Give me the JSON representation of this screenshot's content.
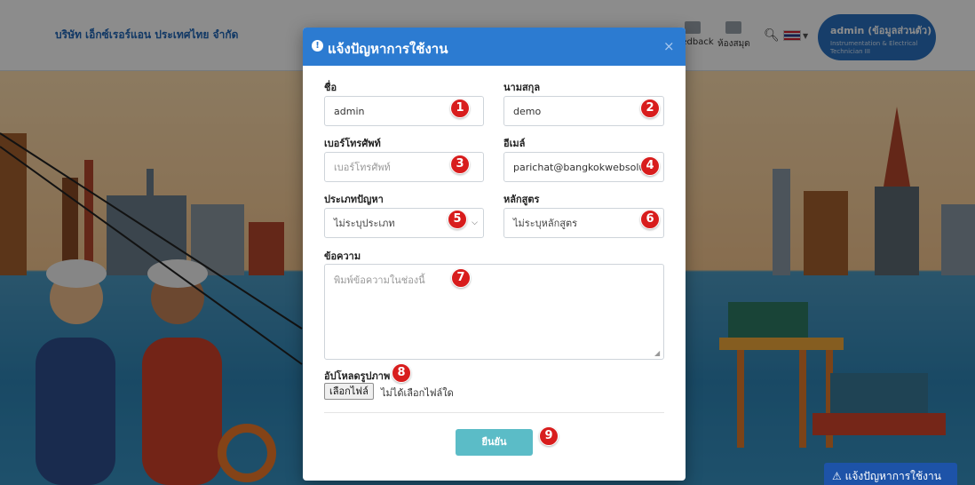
{
  "navbar": {
    "brand": "บริษัท เอ็กซ์เรอร์แอน ประเทศไทย จำกัด",
    "items": [
      {
        "label": "Feedback"
      },
      {
        "label": "ห้องสมุด"
      }
    ],
    "search_icon": "search-icon",
    "language_flag": "thailand-flag-icon",
    "user_name": "admin (ข้อมูลส่วนตัว)",
    "user_role": "Instrumentation & Electrical Technician III"
  },
  "modal": {
    "title": "แจ้งปัญหาการใช้งาน",
    "title_icon": "exclamation-circle-icon",
    "close_icon": "×",
    "header_color": "#2c7bd1",
    "fields": {
      "first_name": {
        "label": "ชื่อ",
        "value": "admin"
      },
      "last_name": {
        "label": "นามสกุล",
        "value": "demo"
      },
      "phone": {
        "label": "เบอร์โทรศัพท์",
        "placeholder": "เบอร์โทรศัพท์",
        "value": ""
      },
      "email": {
        "label": "อีเมล์",
        "value": "parichat@bangkokwebsolution"
      },
      "problem_type": {
        "label": "ประเภทปัญหา",
        "selected": "ไม่ระบุประเภท"
      },
      "course": {
        "label": "หลักสูตร",
        "selected": "ไม่ระบุหลักสูตร"
      },
      "message": {
        "label": "ข้อความ",
        "placeholder": "พิมพ์ข้อความในช่องนี้"
      },
      "upload": {
        "label": "อัปโหลดรูปภาพ",
        "button": "เลือกไฟล์",
        "status": "ไม่ได้เลือกไฟล์ใด"
      }
    },
    "submit_label": "ยืนยัน",
    "submit_color": "#5bbcc7"
  },
  "badges": [
    "1",
    "2",
    "3",
    "4",
    "5",
    "6",
    "7",
    "8",
    "9"
  ],
  "badge_color": "#d81d1d",
  "floating_button": {
    "label": "แจ้งปัญหาการใช้งาน",
    "icon": "warning-icon",
    "color": "#1d53a8"
  }
}
